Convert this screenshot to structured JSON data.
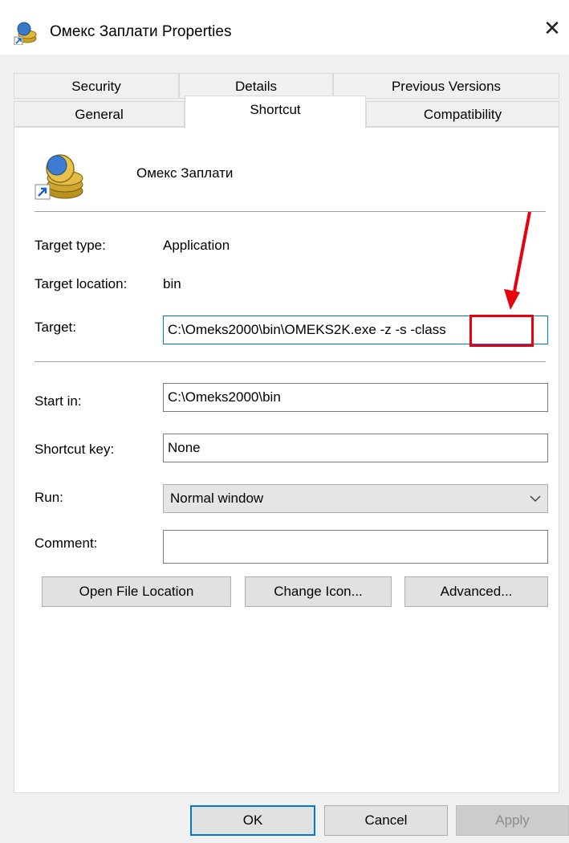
{
  "window": {
    "title": "Омекс Заплати Properties",
    "close_glyph": "✕"
  },
  "tabs": {
    "row1": [
      "Security",
      "Details",
      "Previous Versions"
    ],
    "row2": [
      "General",
      "Shortcut",
      "Compatibility"
    ],
    "active": "Shortcut"
  },
  "shortcut": {
    "app_name": "Омекс Заплати",
    "target_type_label": "Target type:",
    "target_type_value": "Application",
    "target_location_label": "Target location:",
    "target_location_value": "bin",
    "target_label": "Target:",
    "target_value": "C:\\Omeks2000\\bin\\OMEKS2K.exe -z -s -class",
    "start_in_label": "Start in:",
    "start_in_value": "C:\\Omeks2000\\bin",
    "shortcut_key_label": "Shortcut key:",
    "shortcut_key_value": "None",
    "run_label": "Run:",
    "run_value": "Normal window",
    "comment_label": "Comment:",
    "comment_value": ""
  },
  "buttons": {
    "open_file_location": "Open File Location",
    "change_icon": "Change Icon...",
    "advanced": "Advanced...",
    "ok": "OK",
    "cancel": "Cancel",
    "apply": "Apply"
  },
  "annotation": {
    "color": "#e8000d",
    "highlighted_text": "-class"
  }
}
